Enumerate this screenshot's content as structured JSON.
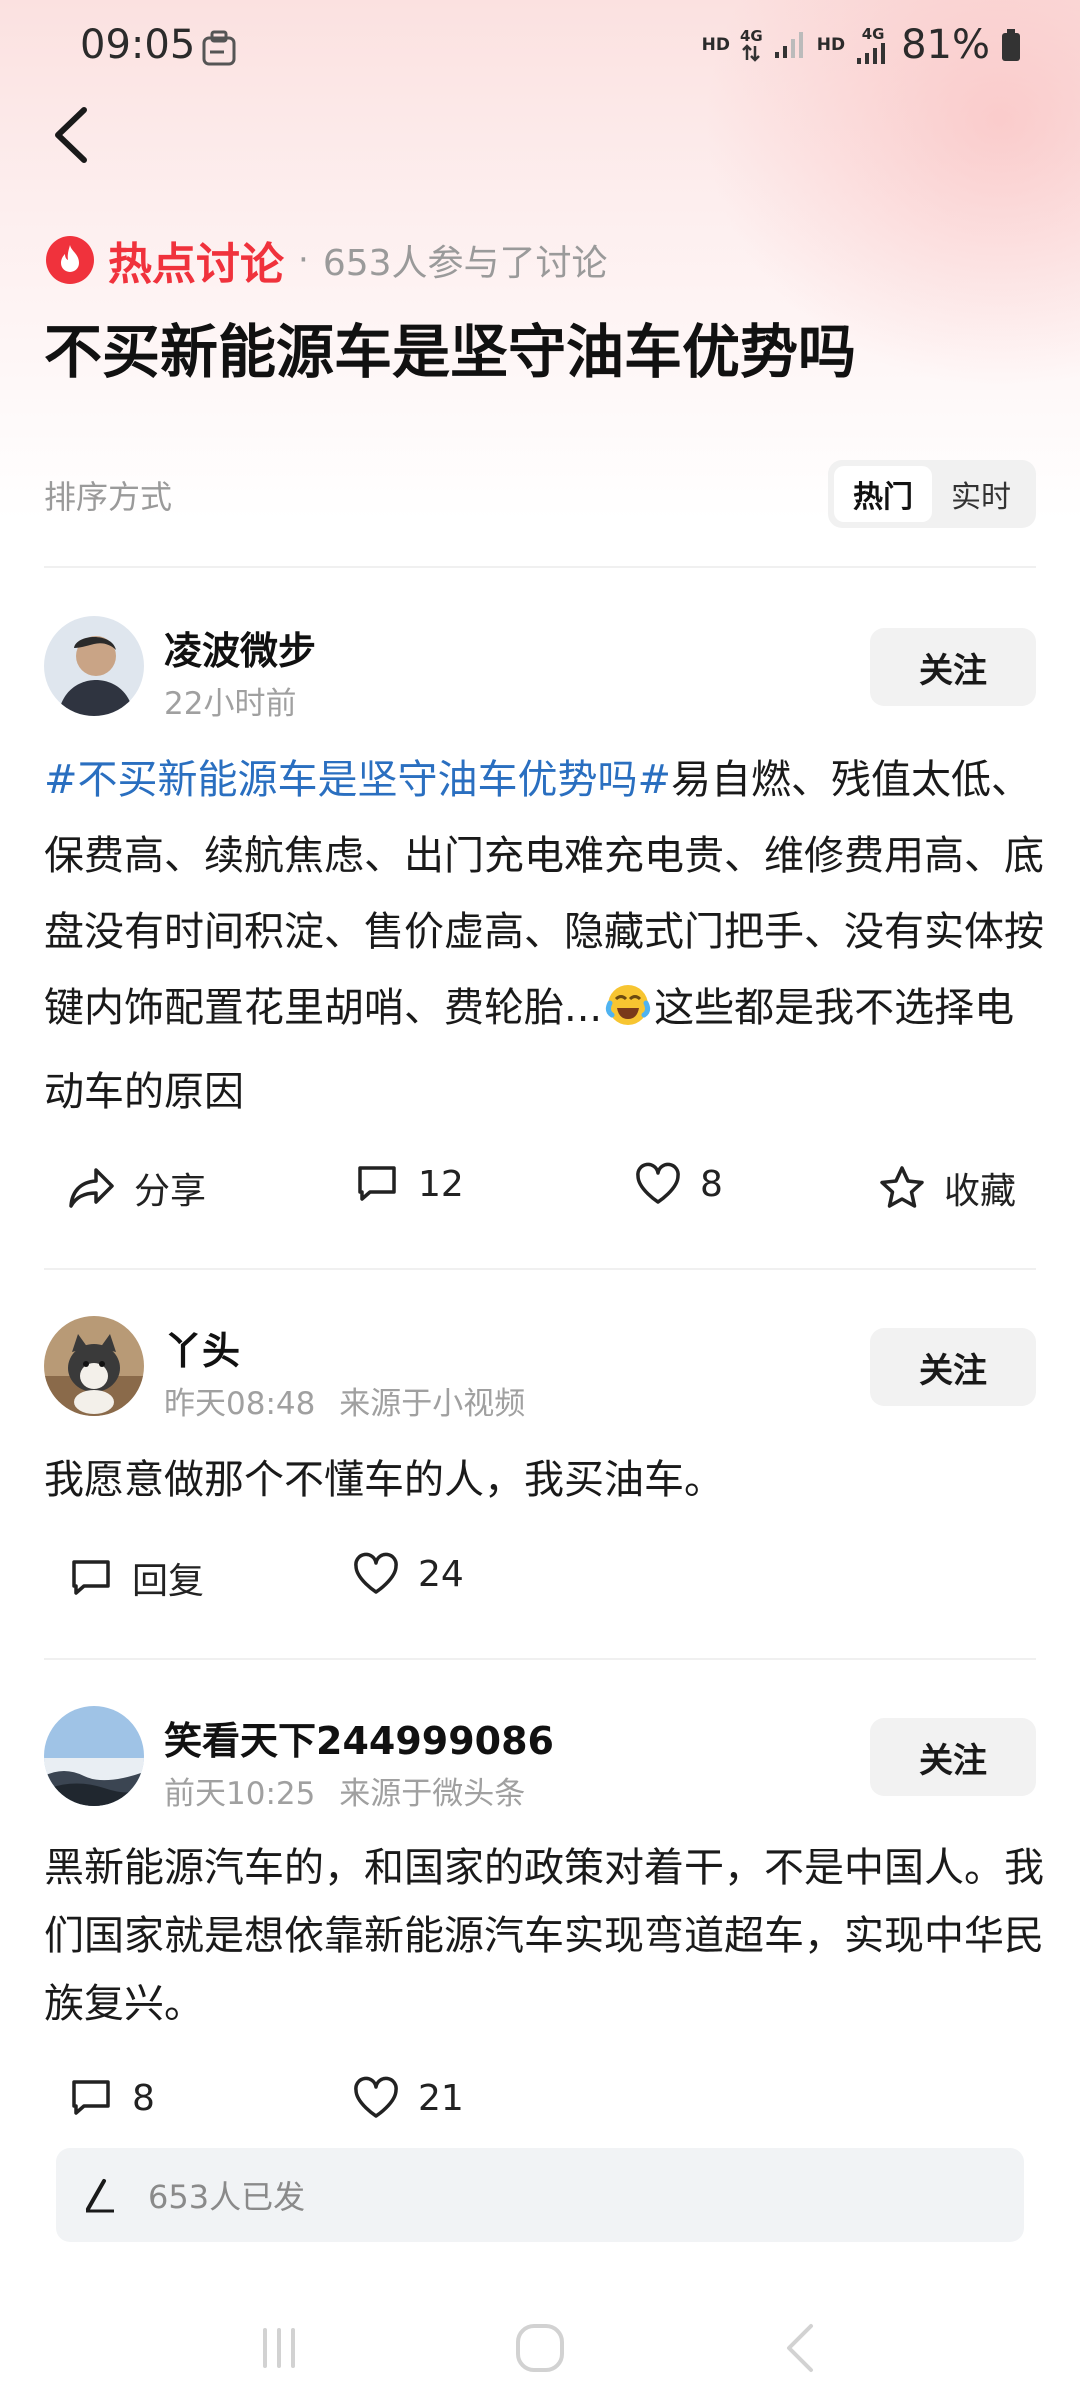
{
  "status_bar": {
    "time": "09:05",
    "network_hd_1": "HD",
    "network_4g_1": "4G",
    "network_hd_2": "HD",
    "network_4g_2": "4G",
    "battery": "81%"
  },
  "header": {
    "topic_label": "热点讨论",
    "dot": "·",
    "participants": "653人参与了讨论",
    "title": "不买新能源车是坚守油车优势吗"
  },
  "sort": {
    "label": "排序方式",
    "options": [
      "热门",
      "实时"
    ],
    "selected": "热门"
  },
  "posts": [
    {
      "username": "凌波微步",
      "time": "22小时前",
      "source": "",
      "follow_label": "关注",
      "hashtag": "#不买新能源车是坚守油车优势吗#",
      "text_before_emoji": "易自燃、残值太低、保费高、续航焦虑、出门充电难充电贵、维修费用高、底盘没有时间积淀、售价虚高、隐藏式门把手、没有实体按键内饰配置花里胡哨、费轮胎...",
      "text_after_emoji": "这些都是我不选择电动车的原因",
      "actions": {
        "share": "分享",
        "comments": "12",
        "likes": "8",
        "favorite": "收藏"
      }
    },
    {
      "username": "丫头",
      "time": "昨天08:48",
      "source": "来源于小视频",
      "follow_label": "关注",
      "text": "我愿意做那个不懂车的人，我买油车。",
      "actions": {
        "reply": "回复",
        "likes": "24"
      }
    },
    {
      "username": "笑看天下244999086",
      "time": "前天10:25",
      "source": "来源于微头条",
      "follow_label": "关注",
      "text": "黑新能源汽车的，和国家的政策对着干，不是中国人。我们国家就是想依靠新能源汽车实现弯道超车，实现中华民族复兴。",
      "actions": {
        "comments": "8",
        "likes": "21"
      }
    }
  ],
  "compose": {
    "placeholder": "653人已发"
  },
  "colors": {
    "accent_red": "#f0323c",
    "hashtag_blue": "#2a6fc0",
    "muted_gray": "#9a9a9a"
  }
}
